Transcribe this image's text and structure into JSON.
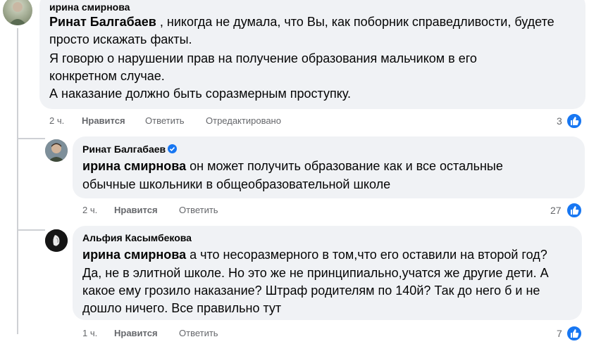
{
  "comments": [
    {
      "author": "ирина смирнова",
      "mention": "Ринат Балгабаев",
      "lines": [
        " , никогда не думала, что Вы, как поборник справедливости, будете",
        "просто искажать факты.",
        "Я говорю о нарушении прав на получение образования мальчиком в его",
        "конкретном случае.",
        "А наказание должно быть соразмерным проступку."
      ],
      "time": "2 ч.",
      "like": "Нравится",
      "reply": "Ответить",
      "edited": "Отредактировано",
      "reactions": "3"
    },
    {
      "author": "Ринат Балгабаев",
      "verified": true,
      "mention": "ирина смирнова",
      "lines": [
        " он может получить образование как и все остальные",
        "обычные школьники в общеобразовательной школе"
      ],
      "time": "2 ч.",
      "like": "Нравится",
      "reply": "Ответить",
      "reactions": "27"
    },
    {
      "author": "Альфия Касымбекова",
      "mention": "ирина смирнова",
      "lines": [
        " а что несоразмерного в том,что его оставили на второй год?",
        "Да, не в элитной школе. Но это же не принципиально,учатся же другие дети. А",
        "какое ему грозило наказание? Штраф родителям по 140й? Так до него б и не",
        "дошло ничего. Все правильно тут"
      ],
      "time": "1 ч.",
      "like": "Нравится",
      "reply": "Ответить",
      "reactions": "7"
    }
  ],
  "colors": {
    "bubble": "#f0f2f5",
    "meta": "#65676b",
    "accent": "#1877f2",
    "thread_line": "#ced0d4"
  },
  "icons": [
    "like-icon",
    "verified-badge-icon",
    "avatar"
  ]
}
